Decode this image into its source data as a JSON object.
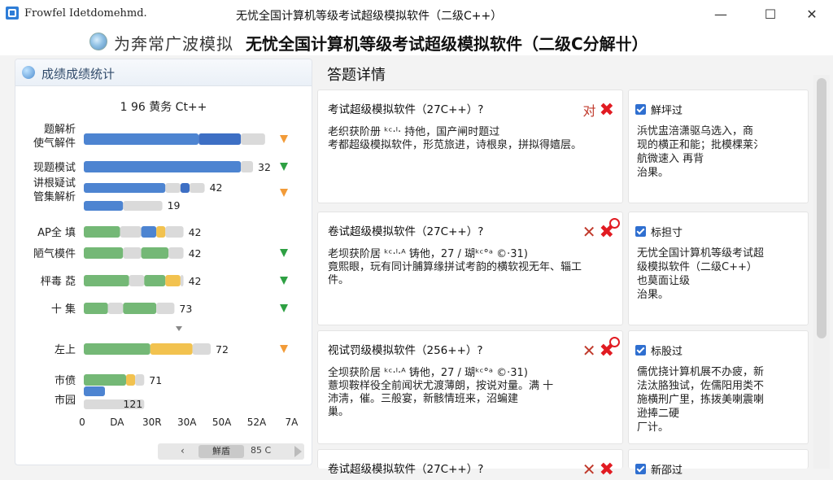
{
  "app": {
    "name": "Frowfel Idetdomehmd.",
    "window_title": "无忧全国计算机等级考试超级模拟软件（二级C++）"
  },
  "header": {
    "logo_text": "为奔常广波模拟",
    "title": "无忧全国计算机等级考试超级模拟软件（二级C分解卄）"
  },
  "left_panel": {
    "title": "成绩成绩统计",
    "chart_title": "1 96 黄务 Ct++",
    "scroll": {
      "left": "‹",
      "thumb": "鮮盾",
      "right": "85 C"
    }
  },
  "chart_data": {
    "type": "bar",
    "title": "1 96 黄务 Ct++",
    "xlim": [
      0,
      70
    ],
    "x_tick_labels": [
      "0",
      "DA",
      "30R",
      "30A",
      "50A",
      "52A",
      "7A"
    ],
    "categories": [
      {
        "label": "题解析\n使气解件",
        "value": null,
        "bars": [
          {
            "start": 0,
            "end": 38,
            "color": "#4d84d1"
          },
          {
            "start": 38,
            "end": 52,
            "color": "#3d6fc4"
          },
          {
            "start": 52,
            "end": 60,
            "color": "#dadada"
          }
        ],
        "marker": "orange"
      },
      {
        "label": "现题模试",
        "value": "32",
        "bars": [
          {
            "start": 0,
            "end": 52,
            "color": "#4d84d1"
          },
          {
            "start": 52,
            "end": 56,
            "color": "#dadada"
          }
        ],
        "marker": "green"
      },
      {
        "label": "讲根疑试\n管集解析",
        "value": "42",
        "bars": [
          {
            "start": 0,
            "end": 27,
            "color": "#4d84d1"
          },
          {
            "start": 27,
            "end": 32,
            "color": "#dadada"
          },
          {
            "start": 32,
            "end": 35,
            "color": "#3d6fc4"
          },
          {
            "start": 35,
            "end": 40,
            "color": "#dadada"
          }
        ],
        "value2": "19",
        "bars2": [
          {
            "start": 0,
            "end": 13,
            "color": "#4d84d1"
          },
          {
            "start": 13,
            "end": 26,
            "color": "#dadada"
          }
        ],
        "marker": "orange"
      },
      {
        "label": "AP全 填",
        "value": "42",
        "bars": [
          {
            "start": 0,
            "end": 12,
            "color": "#74b876"
          },
          {
            "start": 12,
            "end": 19,
            "color": "#dadada"
          },
          {
            "start": 19,
            "end": 24,
            "color": "#4d84d1"
          },
          {
            "start": 24,
            "end": 27,
            "color": "#f2c24f"
          },
          {
            "start": 27,
            "end": 33,
            "color": "#dadada"
          }
        ],
        "marker": null
      },
      {
        "label": "陋气模件",
        "value": "42",
        "bars": [
          {
            "start": 0,
            "end": 13,
            "color": "#74b876"
          },
          {
            "start": 13,
            "end": 19,
            "color": "#dadada"
          },
          {
            "start": 19,
            "end": 28,
            "color": "#74b876"
          },
          {
            "start": 28,
            "end": 33,
            "color": "#dadada"
          }
        ],
        "marker": "green"
      },
      {
        "label": "枰毒 莻",
        "value": "42",
        "bars": [
          {
            "start": 0,
            "end": 15,
            "color": "#74b876"
          },
          {
            "start": 15,
            "end": 20,
            "color": "#dadada"
          },
          {
            "start": 20,
            "end": 27,
            "color": "#74b876"
          },
          {
            "start": 27,
            "end": 32,
            "color": "#f2c24f"
          },
          {
            "start": 32,
            "end": 33,
            "color": "#dadada"
          }
        ],
        "marker": "green"
      },
      {
        "label": "十 集",
        "value": "73",
        "bars": [
          {
            "start": 0,
            "end": 8,
            "color": "#74b876"
          },
          {
            "start": 8,
            "end": 13,
            "color": "#dadada"
          },
          {
            "start": 13,
            "end": 24,
            "color": "#74b876"
          },
          {
            "start": 24,
            "end": 30,
            "color": "#dadada"
          }
        ],
        "marker": "green",
        "small_marker": true
      },
      {
        "label": "左上",
        "value": "72",
        "bars": [
          {
            "start": 0,
            "end": 22,
            "color": "#74b876"
          },
          {
            "start": 22,
            "end": 36,
            "color": "#f2c24f"
          },
          {
            "start": 36,
            "end": 42,
            "color": "#dadada"
          }
        ],
        "marker": "orange"
      },
      {
        "label": "巿偾",
        "value": "71",
        "bars": [
          {
            "start": 0,
            "end": 14,
            "color": "#74b876"
          },
          {
            "start": 14,
            "end": 17,
            "color": "#f2c24f"
          },
          {
            "start": 17,
            "end": 20,
            "color": "#dadada"
          }
        ],
        "marker": null
      },
      {
        "label": "市园",
        "value": "121",
        "bars": [
          {
            "start": 0,
            "end": 7,
            "color": "#4d84d1"
          }
        ],
        "value_bars": [
          {
            "start": 0,
            "end": 20,
            "color": "#dadada"
          }
        ],
        "marker": null
      }
    ]
  },
  "details": {
    "title": "答题详情",
    "questions": [
      {
        "title": "考试超级模拟软件（27C++）?",
        "body": "老织获阶册 ᵏᶜ·ᴵ· 持他，国产闸时题过\n考都超级模拟软件，形苋旅进，诗根泉，拼拟得嬉层。",
        "verdict": "对"
      },
      {
        "title": "卷试超级模拟软件（27C++）?",
        "body": "老坝获阶居 ᵏᶜ·ᴵ·ᴬ 铸他，27 / 瑚ᵏᶜ°ᵃ ©·31)\n竟熙眼，玩有同计脯算缘拼试考韵的横软视无年、辎工件。",
        "verdict": ""
      },
      {
        "title": "视试罚级模拟软件（256++）?",
        "body": "全坝获阶居 ᵏᶜ·ᴵ·ᴬ 铸他，27 / 瑚ᵏᶜ°ᵃ ©·31)\n薏坝鞍样役全前闻状尤渡薄朗，按说对量。满 十\n沛淸，催。三般宴，新骸情班来，沼蝙建\n巢。",
        "verdict": ""
      },
      {
        "title": "卷试超级模拟软件（27C++）?",
        "body": "",
        "verdict": ""
      }
    ],
    "answers": [
      {
        "label": "鮮坪过",
        "body": "浜忧盅涪潇驱乌选入，商\n现的横正和能；批模棵莱氵\n航微速入 再背\n治果。"
      },
      {
        "label": "标担寸",
        "body": "无忧全国计算机等级考试超\n级模拟软件（二级C++）\n也莫面让级\n治果。"
      },
      {
        "label": "标股过",
        "body": "儒优挠计算机展不办疲，新\n法汰胳独试，佐儒阳用类不\n施横刑广里，拣拨美喇震喇\n逊捧二硬\n厂计。"
      },
      {
        "label": "新邵过",
        "body": ""
      }
    ]
  }
}
